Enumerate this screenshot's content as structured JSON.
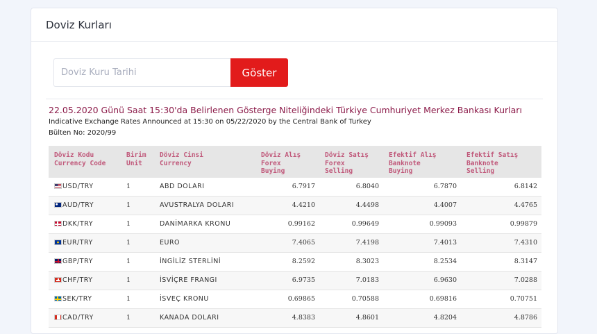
{
  "card": {
    "title": "Doviz Kurları"
  },
  "search": {
    "placeholder": "Doviz Kuru Tarihi",
    "value": "",
    "button_label": "Göster"
  },
  "bulletin": {
    "title": "22.05.2020 Günü Saat 15:30'da Belirlenen Gösterge Niteliğindeki Türkiye Cumhuriyet Merkez Bankası Kurları",
    "subtitle": "Indicative Exchange Rates Announced at 15:30 on 05/22/2020 by the Central Bank of Turkey",
    "number": "Bülten No: 2020/99"
  },
  "table": {
    "headers": [
      [
        "Döviz Kodu",
        "Currency Code"
      ],
      [
        "Birim",
        "Unit"
      ],
      [
        "Döviz Cinsi",
        "Currency"
      ],
      [
        "Döviz Alış",
        "Forex",
        "Buying"
      ],
      [
        "Döviz Satış",
        "Forex",
        "Selling"
      ],
      [
        "Efektif Alış",
        "Banknote",
        "Buying"
      ],
      [
        "Efektif Satış",
        "Banknote",
        "Selling"
      ]
    ],
    "rows": [
      {
        "flag": "us-flag-icon",
        "code": "USD/TRY",
        "unit": "1",
        "name": "ABD DOLARI",
        "forex_buy": "6.7917",
        "forex_sell": "6.8040",
        "bank_buy": "6.7870",
        "bank_sell": "6.8142"
      },
      {
        "flag": "au-flag-icon",
        "code": "AUD/TRY",
        "unit": "1",
        "name": "AVUSTRALYA DOLARI",
        "forex_buy": "4.4210",
        "forex_sell": "4.4498",
        "bank_buy": "4.4007",
        "bank_sell": "4.4765"
      },
      {
        "flag": "dk-flag-icon",
        "code": "DKK/TRY",
        "unit": "1",
        "name": "DANİMARKA KRONU",
        "forex_buy": "0.99162",
        "forex_sell": "0.99649",
        "bank_buy": "0.99093",
        "bank_sell": "0.99879"
      },
      {
        "flag": "eu-flag-icon",
        "code": "EUR/TRY",
        "unit": "1",
        "name": "EURO",
        "forex_buy": "7.4065",
        "forex_sell": "7.4198",
        "bank_buy": "7.4013",
        "bank_sell": "7.4310"
      },
      {
        "flag": "gb-flag-icon",
        "code": "GBP/TRY",
        "unit": "1",
        "name": "İNGİLİZ STERLİNİ",
        "forex_buy": "8.2592",
        "forex_sell": "8.3023",
        "bank_buy": "8.2534",
        "bank_sell": "8.3147"
      },
      {
        "flag": "ch-flag-icon",
        "code": "CHF/TRY",
        "unit": "1",
        "name": "İSVİÇRE FRANGI",
        "forex_buy": "6.9735",
        "forex_sell": "7.0183",
        "bank_buy": "6.9630",
        "bank_sell": "7.0288"
      },
      {
        "flag": "se-flag-icon",
        "code": "SEK/TRY",
        "unit": "1",
        "name": "İSVEÇ KRONU",
        "forex_buy": "0.69865",
        "forex_sell": "0.70588",
        "bank_buy": "0.69816",
        "bank_sell": "0.70751"
      },
      {
        "flag": "ca-flag-icon",
        "code": "CAD/TRY",
        "unit": "1",
        "name": "KANADA DOLARI",
        "forex_buy": "4.8383",
        "forex_sell": "4.8601",
        "bank_buy": "4.8204",
        "bank_sell": "4.8786"
      }
    ]
  }
}
